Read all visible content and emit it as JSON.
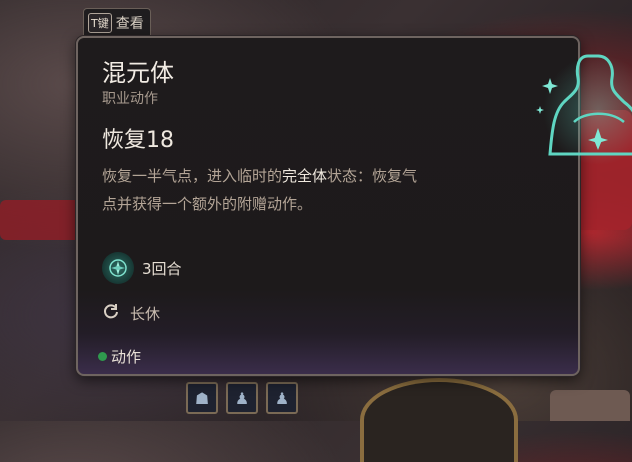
{
  "hint": {
    "key": "T键",
    "label": "查看"
  },
  "tooltip": {
    "title": "混元体",
    "subtitle": "职业动作",
    "effect_name": "恢复18",
    "description": {
      "part1": "恢复一半气点，进入临时的",
      "highlight": "完全体",
      "part2": "状态：恢复气点并获得一个额外的附赠动作。"
    },
    "uses": {
      "icon": "ki-icon",
      "value": "3回合"
    },
    "recharge": {
      "icon": "refresh-icon",
      "value": "长休"
    },
    "action_type": {
      "icon": "green-dot-icon",
      "value": "动作"
    }
  },
  "colors": {
    "panel_bg": "#1e1b1c",
    "accent_teal": "#5fd6c2",
    "action_green": "#2f9a4e",
    "text_primary": "#f2ece4",
    "text_secondary": "#b3a496"
  }
}
